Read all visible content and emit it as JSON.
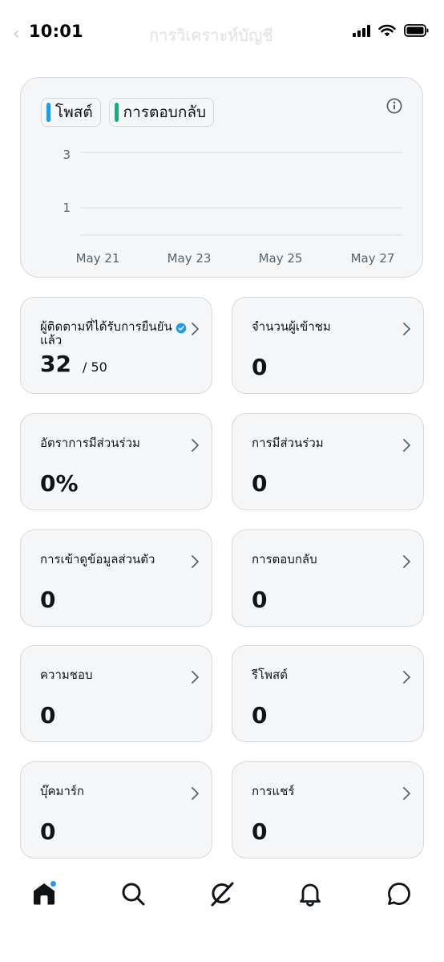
{
  "status_bar": {
    "time": "10:01",
    "header_title": "การวิเคราะห์บัญชี"
  },
  "chart": {
    "legend": [
      {
        "label": "โพสต์",
        "color": "#1d9bf0"
      },
      {
        "label": "การตอบกลับ",
        "color": "#00ba7c"
      }
    ],
    "info_icon": "info-icon"
  },
  "chart_data": {
    "type": "line",
    "x": [
      "May 21",
      "May 23",
      "May 25",
      "May 27"
    ],
    "y_ticks": [
      "3",
      "1"
    ],
    "series": [
      {
        "name": "โพสต์",
        "color": "#1d9bf0",
        "values": []
      },
      {
        "name": "การตอบกลับ",
        "color": "#00ba7c",
        "values": []
      }
    ],
    "grid": true
  },
  "stats": [
    {
      "label": "ผู้ติดตามที่ได้รับการยืนยันแล้ว",
      "value": "32",
      "suffix": "/ 50",
      "verified": true
    },
    {
      "label": "จำนวนผู้เข้าชม",
      "value": "0"
    },
    {
      "label": "อัตราการมีส่วนร่วม",
      "value": "0%"
    },
    {
      "label": "การมีส่วนร่วม",
      "value": "0"
    },
    {
      "label": "การเข้าดูข้อมูลส่วนตัว",
      "value": "0"
    },
    {
      "label": "การตอบกลับ",
      "value": "0"
    },
    {
      "label": "ความชอบ",
      "value": "0"
    },
    {
      "label": "รีโพสต์",
      "value": "0"
    },
    {
      "label": "บุ๊คมาร์ก",
      "value": "0"
    },
    {
      "label": "การแชร์",
      "value": "0"
    }
  ],
  "bottom_nav": {
    "items": [
      "home-icon",
      "search-icon",
      "grok-icon",
      "notifications-icon",
      "messages-icon"
    ],
    "accent": "#1d9bf0"
  }
}
